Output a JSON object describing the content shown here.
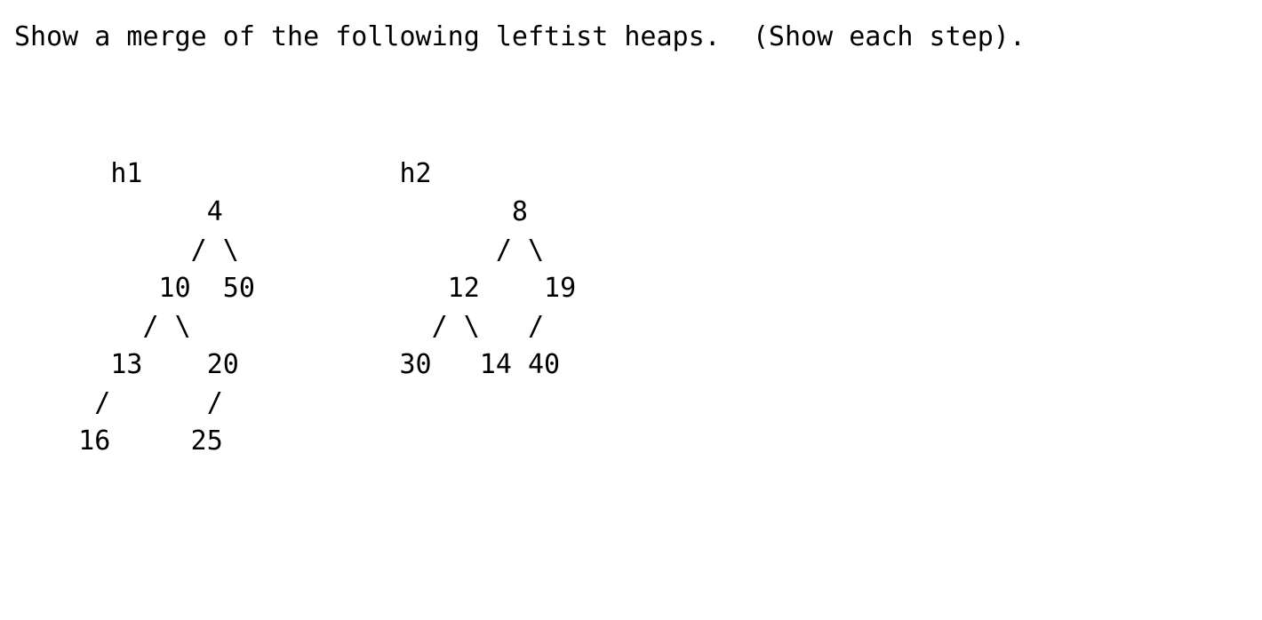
{
  "document": {
    "title": "Leftist Heap Merge Problem",
    "background_color": "#ffffff",
    "text_color": "#000000"
  },
  "prompt": {
    "text": "Show a merge of the following leftist heaps.  (Show each step)."
  },
  "heaps": [
    {
      "id": "h1",
      "label": "h1",
      "root": 4,
      "nodes": [
        4,
        10,
        50,
        13,
        20,
        16,
        25
      ],
      "ascii": [
        "      h1",
        "            4",
        "           / \\",
        "         10  50",
        "        / \\",
        "      13    20",
        "     /      /",
        "    16     25"
      ],
      "ascii_text": "      h1\n            4\n           / \\\n         10  50\n        / \\\n      13    20\n     /      /\n    16     25"
    },
    {
      "id": "h2",
      "label": "h2",
      "root": 8,
      "nodes": [
        8,
        12,
        19,
        30,
        14,
        40
      ],
      "ascii": [
        "                        h2",
        "                               8",
        "                              / \\",
        "                           12    19",
        "                          / \\   /",
        "                        30   14 40"
      ],
      "ascii_text": "                        h2\n                               8\n                              / \\\n                           12    19\n                          / \\   /\n                        30   14 40"
    }
  ],
  "tree_data": {
    "h1": {
      "label": "h1",
      "structure": {
        "value": 4,
        "left": {
          "value": 10,
          "left": {
            "value": 13,
            "left": {
              "value": 16
            }
          },
          "right": {
            "value": 20,
            "left": {
              "value": 25
            }
          }
        },
        "right": {
          "value": 50
        }
      }
    },
    "h2": {
      "label": "h2",
      "structure": {
        "value": 8,
        "left": {
          "value": 12,
          "left": {
            "value": 30
          },
          "right": {
            "value": 14
          }
        },
        "right": {
          "value": 19,
          "left": {
            "value": 40
          }
        }
      }
    }
  }
}
